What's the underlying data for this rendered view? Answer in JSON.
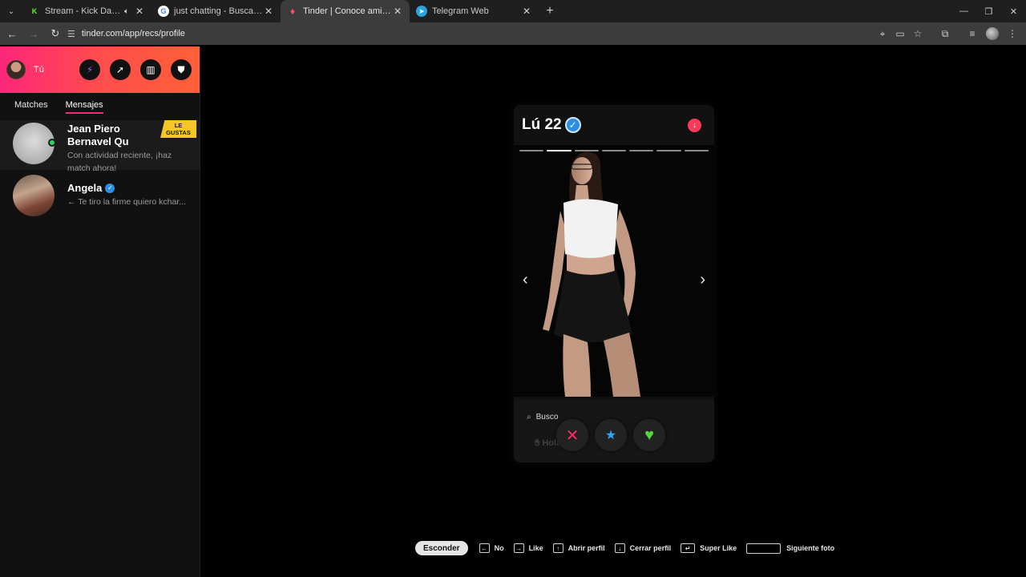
{
  "browser": {
    "tabs": [
      {
        "title": "Stream - Kick Dashboard",
        "favicon": "kick-icon",
        "color": "#53fc18"
      },
      {
        "title": "just chatting - Buscar con Goog",
        "favicon": "google-icon",
        "color": "#ffffff"
      },
      {
        "title": "Tinder | Conoce amigos y gente",
        "favicon": "tinder-icon",
        "color": "#fd5068"
      },
      {
        "title": "Telegram Web",
        "favicon": "telegram-icon",
        "color": "#2aa3e0"
      }
    ],
    "url": "tinder.com/app/recs/profile"
  },
  "sidebar": {
    "me_label": "Tú",
    "tabs": [
      "Matches",
      "Mensajes"
    ],
    "messages": [
      {
        "name": "Jean Piero Bernavel Qu",
        "text": "Con actividad reciente, ¡haz match ahora!",
        "badge_line1": "LE",
        "badge_line2": "GUSTAS"
      },
      {
        "name": "Angela",
        "text": "← Te tiro la firme quiero kchar..."
      }
    ]
  },
  "card": {
    "name_age": "Lú 22",
    "photo_count": 7,
    "active_photo": 2,
    "busco_label": "Busco",
    "faded_text": "Hola amig"
  },
  "shortcuts": {
    "hide": "Esconder",
    "no": "No",
    "like": "Like",
    "open": "Abrir perfil",
    "close": "Cerrar perfil",
    "superlike": "Super Like",
    "next_photo": "Siguiente foto"
  },
  "colors": {
    "brand_gradient_start": "#fd267a",
    "brand_gradient_end": "#ff6036",
    "verified_blue": "#2b8fe6",
    "badge_yellow": "#f6c626"
  }
}
